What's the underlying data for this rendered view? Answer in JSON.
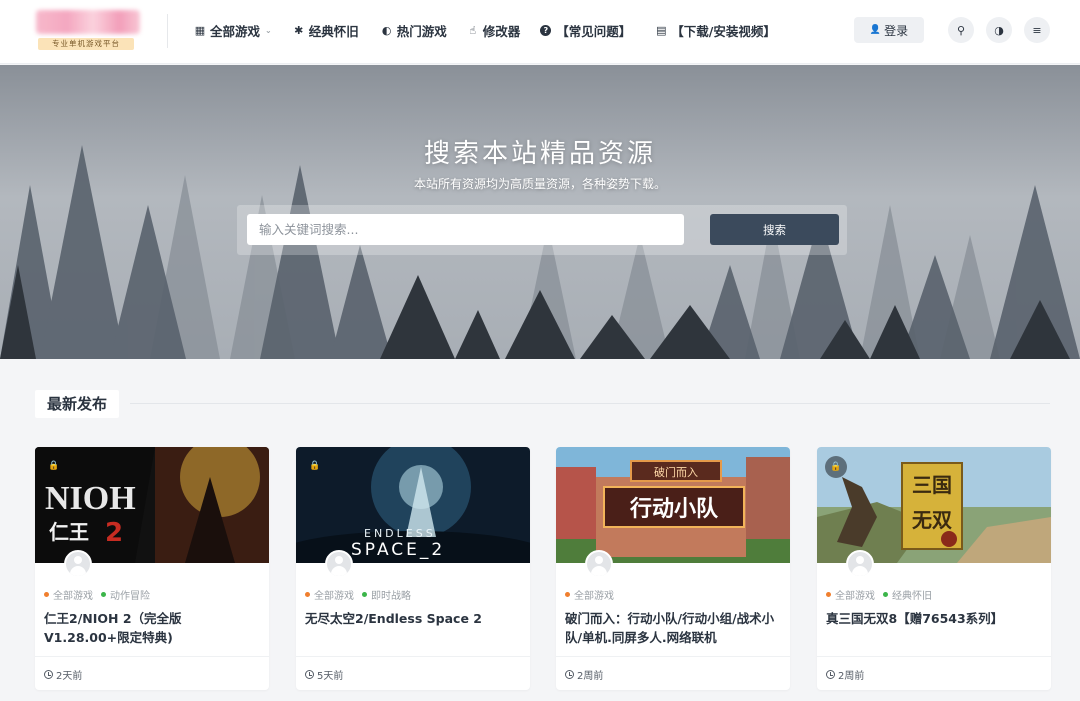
{
  "header": {
    "logo_tagline": "专业单机游戏平台",
    "nav": [
      {
        "label": "全部游戏",
        "icon": "grid-icon",
        "glyph": "▦",
        "has_dropdown": true
      },
      {
        "label": "经典怀旧",
        "icon": "asterisk-icon",
        "glyph": "✱"
      },
      {
        "label": "热门游戏",
        "icon": "flame-icon",
        "glyph": "◐"
      },
      {
        "label": "修改器",
        "icon": "thumbs-up-icon",
        "glyph": "☝"
      },
      {
        "label": "【常见问题】",
        "icon": "question-circle-icon",
        "glyph": "?"
      },
      {
        "label": "【下载/安装视频】",
        "icon": "film-icon",
        "glyph": "▤"
      }
    ],
    "login_label": "登录",
    "buttons": [
      {
        "icon": "search-icon",
        "glyph": "⚲"
      },
      {
        "icon": "theme-toggle-icon",
        "glyph": "◑"
      },
      {
        "icon": "menu-icon",
        "glyph": "≡"
      }
    ]
  },
  "hero": {
    "title": "搜索本站精品资源",
    "subtitle": "本站所有资源均为高质量资源，各种姿势下载。",
    "search_placeholder": "输入关键词搜索...",
    "search_button": "搜索"
  },
  "latest": {
    "heading": "最新发布",
    "cards": [
      {
        "thumb_text": "NIOH 仁王2",
        "tags": [
          {
            "label": "全部游戏",
            "color": "#f07f2e"
          },
          {
            "label": "动作冒险",
            "color": "#3bb54a"
          }
        ],
        "title": "仁王2/NIOH 2（完全版V1.28.00+限定特典)",
        "time": "2天前",
        "locked": true
      },
      {
        "thumb_text": "ENDLESS SPACE_2",
        "tags": [
          {
            "label": "全部游戏",
            "color": "#f07f2e"
          },
          {
            "label": "即时战略",
            "color": "#3bb54a"
          }
        ],
        "title": "无尽太空2/Endless Space 2",
        "time": "5天前",
        "locked": true
      },
      {
        "thumb_text": "破门而入 行动小队",
        "tags": [
          {
            "label": "全部游戏",
            "color": "#f07f2e"
          }
        ],
        "title": "破门而入：行动小队/行动小组/战术小队/单机.同屏多人.网络联机",
        "time": "2周前",
        "locked": false
      },
      {
        "thumb_text": "真三国无双8",
        "tags": [
          {
            "label": "全部游戏",
            "color": "#f07f2e"
          },
          {
            "label": "经典怀旧",
            "color": "#3bb54a"
          }
        ],
        "title": "真三国无双8【赠76543系列】",
        "time": "2周前",
        "locked": true
      }
    ]
  }
}
